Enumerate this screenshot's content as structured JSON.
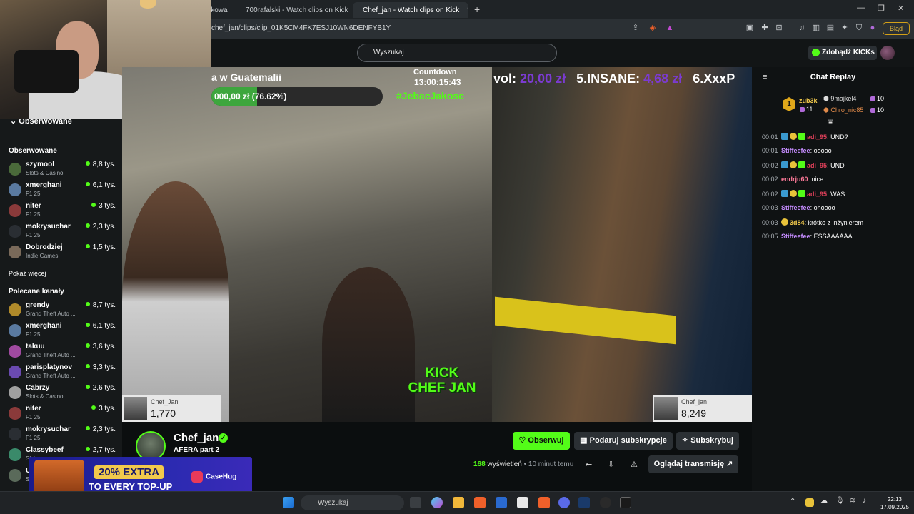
{
  "browser": {
    "tabs": [
      {
        "label": "wkowa"
      },
      {
        "label": "700rafalski - Watch clips on Kick"
      },
      {
        "label": "Chef_jan - Watch clips on Kick",
        "close": "✕"
      }
    ],
    "new_tab": "+",
    "url": "chef_jan/clips/clip_01K5CM4FK7ESJ10WN6DENFYB1Y",
    "error_badge": "Błąd",
    "window_controls": [
      "—",
      "❐",
      "✕"
    ]
  },
  "header": {
    "search_placeholder": "Wyszukaj",
    "kicks_button": "Zdobądź KICKs"
  },
  "sidebar": {
    "followed_toggle": "Obserwowane",
    "followed_heading": "Obserwowane",
    "followed": [
      {
        "name": "szymool",
        "category": "Slots & Casino",
        "viewers": "8,8 tys.",
        "color": "#4a6a3a"
      },
      {
        "name": "xmerghani",
        "category": "F1 25",
        "viewers": "6,1 tys.",
        "color": "#5a7aa0"
      },
      {
        "name": "niter",
        "category": "F1 25",
        "viewers": "3 tys.",
        "color": "#8a3a3a"
      },
      {
        "name": "mokrysuchar",
        "category": "F1 25",
        "viewers": "2,3 tys.",
        "color": "#2a2e33"
      },
      {
        "name": "Dobrodziej",
        "category": "Indie Games",
        "viewers": "1,5 tys.",
        "color": "#7a6a5a"
      }
    ],
    "show_more": "Pokaż więcej",
    "recommended_heading": "Polecane kanały",
    "recommended": [
      {
        "name": "grendy",
        "category": "Grand Theft Auto ...",
        "viewers": "8,7 tys.",
        "color": "#b08a2a"
      },
      {
        "name": "xmerghani",
        "category": "F1 25",
        "viewers": "6,1 tys.",
        "color": "#5a7aa0"
      },
      {
        "name": "takuu",
        "category": "Grand Theft Auto ...",
        "viewers": "3,6 tys.",
        "color": "#a04aa0"
      },
      {
        "name": "parisplatynov",
        "category": "Grand Theft Auto ...",
        "viewers": "3,3 tys.",
        "color": "#6a4ab0"
      },
      {
        "name": "Cabrzy",
        "category": "Slots & Casino",
        "viewers": "2,6 tys.",
        "color": "#a0a0a0"
      },
      {
        "name": "niter",
        "category": "F1 25",
        "viewers": "3 tys.",
        "color": "#8a3a3a"
      },
      {
        "name": "mokrysuchar",
        "category": "F1 25",
        "viewers": "2,3 tys.",
        "color": "#2a2e33"
      },
      {
        "name": "Classybeef",
        "category": "Slots",
        "viewers": "2,7 tys.",
        "color": "#3a8a6a"
      },
      {
        "name": "Ul",
        "category": "Sc",
        "viewers": "",
        "color": "#5a6a5a"
      }
    ]
  },
  "video": {
    "goal_label": "a w Guatemalii",
    "goal_text": "000,00 zł (76.62%)",
    "goal_progress": 0.2666,
    "countdown_label": "Countdown",
    "countdown_time": "13:00:15:43",
    "countdown_code": "#JebacJakosc",
    "leaderboard_a": "vol:",
    "leaderboard_a_value": "20,00 zł",
    "leaderboard_b": "5.INSANE:",
    "leaderboard_b_value": "4,68 zł",
    "leaderboard_c": "6.XxxP",
    "kick_logo_top": "KICK",
    "kick_logo_bottom": "CHEF JAN",
    "card_left_name": "Chef_Jan",
    "card_left_count": "1,770",
    "card_right_name": "Chef_jan",
    "card_right_count": "8,249"
  },
  "channel": {
    "name": "Chef_jan",
    "clip_title": "AFERA part 2",
    "follow": "Obserwuj",
    "gift_sub": "Podaruj subskrypcje",
    "subscribe": "Subskrybuj",
    "views_count": "168",
    "views_word": "wyświetleń",
    "time_ago": "• 10 minut temu",
    "watch_stream": "Oglądaj transmisję"
  },
  "ad": {
    "top": "20% EXTRA",
    "bottom": "TO EVERY TOP-UP",
    "brand": "CaseHug"
  },
  "chat": {
    "title": "Chat Replay",
    "leaderboard": [
      {
        "name": "zub3k",
        "count": "11"
      },
      {
        "name": "9majkel4",
        "count": "10"
      },
      {
        "name": "Chro_nic85",
        "count": "10"
      }
    ],
    "messages": [
      {
        "time": "00:01",
        "user": "adi_95",
        "text": ": UND?",
        "color": "#e0405a",
        "badges": true
      },
      {
        "time": "00:01",
        "user": "Stiffeefee",
        "text": ": ooooo",
        "color": "#c58cff",
        "badges": false
      },
      {
        "time": "00:02",
        "user": "adi_95",
        "text": ": UND",
        "color": "#e0405a",
        "badges": true
      },
      {
        "time": "00:02",
        "user": "endrju60",
        "text": ": nice",
        "color": "#ff7a9a",
        "badges": false
      },
      {
        "time": "00:02",
        "user": "adi_95",
        "text": ": WAS",
        "color": "#e0405a",
        "badges": true
      },
      {
        "time": "00:03",
        "user": "Stiffeefee",
        "text": ": ohoooo",
        "color": "#c58cff",
        "badges": false
      },
      {
        "time": "00:03",
        "user": "3d84",
        "text": ": krótko z inżynierem",
        "color": "#f2c94c",
        "badges": false
      },
      {
        "time": "00:05",
        "user": "Stiffeefee",
        "text": ": ESSAAAAAA",
        "color": "#c58cff",
        "badges": false
      }
    ]
  },
  "taskbar": {
    "search": "Wyszukaj",
    "time": "22:13",
    "date": "17.09.2025"
  }
}
